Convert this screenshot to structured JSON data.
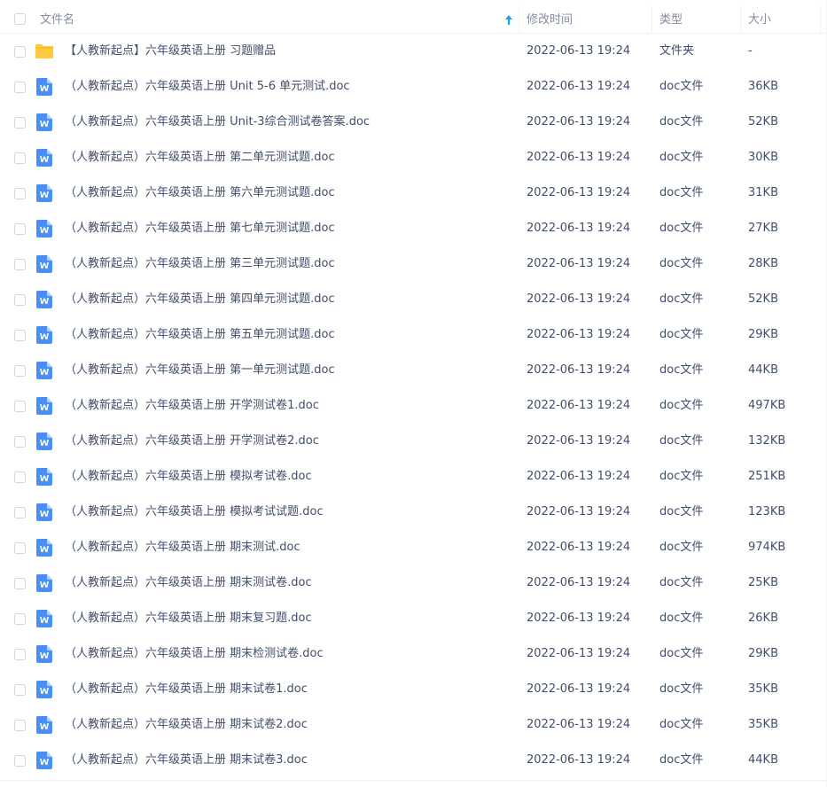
{
  "header": {
    "name_label": "文件名",
    "time_label": "修改时间",
    "type_label": "类型",
    "size_label": "大小",
    "sort_icon": "arrow-up-icon"
  },
  "colors": {
    "doc_icon": "#4a8ff7",
    "folder_icon": "#ffc93d",
    "sort_arrow": "#06a7ff",
    "text": "#424e67",
    "header_text": "#878c9c"
  },
  "rows": [
    {
      "name": "【人教新起点】六年级英语上册 习题赠品",
      "time": "2022-06-13 19:24",
      "type": "文件夹",
      "size": "-",
      "icon": "folder-icon"
    },
    {
      "name": "（人教新起点）六年级英语上册  Unit 5-6 单元测试.doc",
      "time": "2022-06-13 19:24",
      "type": "doc文件",
      "size": "36KB",
      "icon": "word-doc-icon"
    },
    {
      "name": "（人教新起点）六年级英语上册 Unit-3综合测试卷答案.doc",
      "time": "2022-06-13 19:24",
      "type": "doc文件",
      "size": "52KB",
      "icon": "word-doc-icon"
    },
    {
      "name": "（人教新起点）六年级英语上册 第二单元测试题.doc",
      "time": "2022-06-13 19:24",
      "type": "doc文件",
      "size": "30KB",
      "icon": "word-doc-icon"
    },
    {
      "name": "（人教新起点）六年级英语上册 第六单元测试题.doc",
      "time": "2022-06-13 19:24",
      "type": "doc文件",
      "size": "31KB",
      "icon": "word-doc-icon"
    },
    {
      "name": "（人教新起点）六年级英语上册 第七单元测试题.doc",
      "time": "2022-06-13 19:24",
      "type": "doc文件",
      "size": "27KB",
      "icon": "word-doc-icon"
    },
    {
      "name": "（人教新起点）六年级英语上册 第三单元测试题.doc",
      "time": "2022-06-13 19:24",
      "type": "doc文件",
      "size": "28KB",
      "icon": "word-doc-icon"
    },
    {
      "name": "（人教新起点）六年级英语上册 第四单元测试题.doc",
      "time": "2022-06-13 19:24",
      "type": "doc文件",
      "size": "52KB",
      "icon": "word-doc-icon"
    },
    {
      "name": "（人教新起点）六年级英语上册 第五单元测试题.doc",
      "time": "2022-06-13 19:24",
      "type": "doc文件",
      "size": "29KB",
      "icon": "word-doc-icon"
    },
    {
      "name": "（人教新起点）六年级英语上册 第一单元测试题.doc",
      "time": "2022-06-13 19:24",
      "type": "doc文件",
      "size": "44KB",
      "icon": "word-doc-icon"
    },
    {
      "name": "（人教新起点）六年级英语上册 开学测试卷1.doc",
      "time": "2022-06-13 19:24",
      "type": "doc文件",
      "size": "497KB",
      "icon": "word-doc-icon"
    },
    {
      "name": "（人教新起点）六年级英语上册 开学测试卷2.doc",
      "time": "2022-06-13 19:24",
      "type": "doc文件",
      "size": "132KB",
      "icon": "word-doc-icon"
    },
    {
      "name": "（人教新起点）六年级英语上册 模拟考试卷.doc",
      "time": "2022-06-13 19:24",
      "type": "doc文件",
      "size": "251KB",
      "icon": "word-doc-icon"
    },
    {
      "name": "（人教新起点）六年级英语上册 模拟考试试题.doc",
      "time": "2022-06-13 19:24",
      "type": "doc文件",
      "size": "123KB",
      "icon": "word-doc-icon"
    },
    {
      "name": "（人教新起点）六年级英语上册 期末测试.doc",
      "time": "2022-06-13 19:24",
      "type": "doc文件",
      "size": "974KB",
      "icon": "word-doc-icon"
    },
    {
      "name": "（人教新起点）六年级英语上册 期末测试卷.doc",
      "time": "2022-06-13 19:24",
      "type": "doc文件",
      "size": "25KB",
      "icon": "word-doc-icon"
    },
    {
      "name": "（人教新起点）六年级英语上册 期末复习题.doc",
      "time": "2022-06-13 19:24",
      "type": "doc文件",
      "size": "26KB",
      "icon": "word-doc-icon"
    },
    {
      "name": "（人教新起点）六年级英语上册 期末检测试卷.doc",
      "time": "2022-06-13 19:24",
      "type": "doc文件",
      "size": "29KB",
      "icon": "word-doc-icon"
    },
    {
      "name": "（人教新起点）六年级英语上册 期末试卷1.doc",
      "time": "2022-06-13 19:24",
      "type": "doc文件",
      "size": "35KB",
      "icon": "word-doc-icon"
    },
    {
      "name": "（人教新起点）六年级英语上册 期末试卷2.doc",
      "time": "2022-06-13 19:24",
      "type": "doc文件",
      "size": "35KB",
      "icon": "word-doc-icon"
    },
    {
      "name": "（人教新起点）六年级英语上册 期末试卷3.doc",
      "time": "2022-06-13 19:24",
      "type": "doc文件",
      "size": "44KB",
      "icon": "word-doc-icon"
    }
  ]
}
